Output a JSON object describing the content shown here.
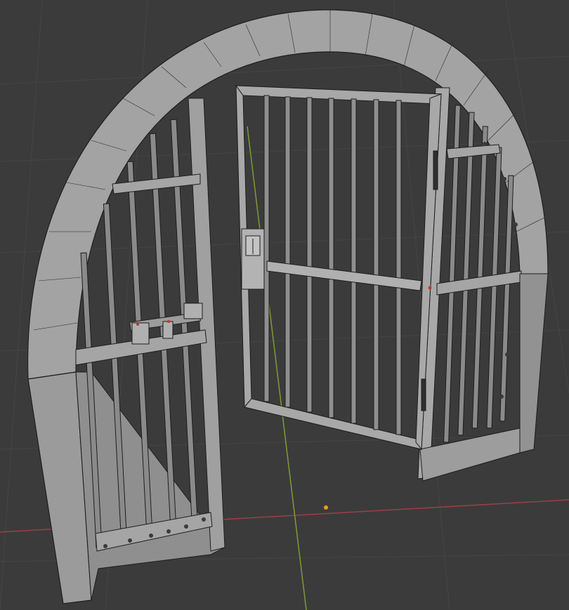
{
  "viewport": {
    "background": "#3b3b3b",
    "grid_color": "#454545",
    "x_axis_color": "#9a3f48",
    "y_axis_color": "#7f9a36",
    "origin_color": "#f39a16"
  },
  "model": {
    "fill": "#9b9b9b",
    "fill_dark": "#6f6f6f",
    "wire": "#1e1e1e",
    "bar": "#8a8a8a",
    "selected_vertex_color": "#c0392b"
  }
}
